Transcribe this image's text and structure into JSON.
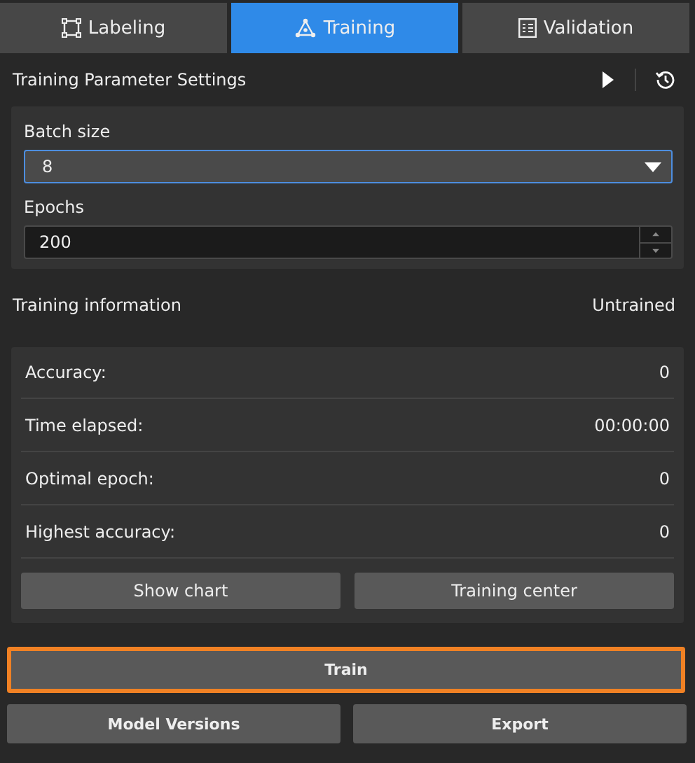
{
  "tabs": [
    {
      "label": "Labeling",
      "selected": false
    },
    {
      "label": "Training",
      "selected": true
    },
    {
      "label": "Validation",
      "selected": false
    }
  ],
  "parameters": {
    "title": "Training Parameter Settings",
    "fields": [
      {
        "kind": "select",
        "label": "Batch size",
        "value": "8",
        "focused": true
      },
      {
        "kind": "spinbox",
        "label": "Epochs",
        "value": "200",
        "focused": false
      }
    ]
  },
  "training_info": {
    "title": "Training information",
    "status": "Untrained",
    "rows": [
      {
        "label": "Accuracy:",
        "value": "0"
      },
      {
        "label": "Time elapsed:",
        "value": "00:00:00"
      },
      {
        "label": "Optimal epoch:",
        "value": "0"
      },
      {
        "label": "Highest accuracy:",
        "value": "0"
      }
    ],
    "buttons": [
      "Show chart",
      "Training center"
    ]
  },
  "train_button": {
    "label": "Train",
    "focused": true
  },
  "bottom_buttons": [
    "Model Versions",
    "Export"
  ]
}
